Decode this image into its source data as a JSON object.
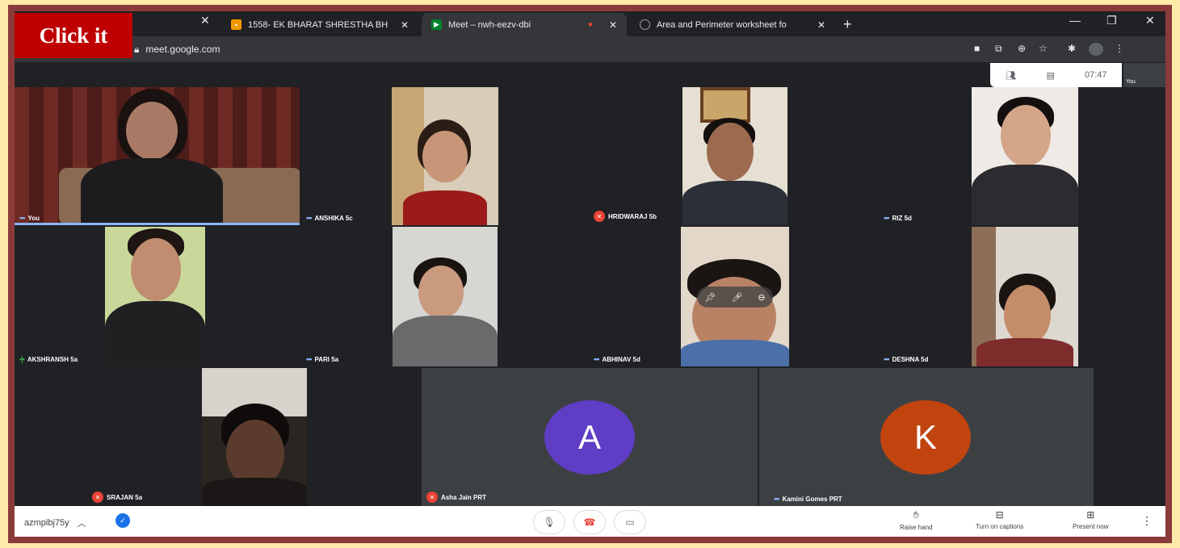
{
  "overlay": {
    "click_label": "Click it"
  },
  "browser": {
    "tabs": [
      {
        "title": "1558- EK BHARAT SHRESTHA BH",
        "icon": "slides-icon",
        "color": "#f29900"
      },
      {
        "title": "Meet – nwh-eezv-dbi",
        "icon": "meet-icon",
        "color": "#00832d"
      },
      {
        "title": "Area and Perimeter worksheet fo",
        "icon": "globe-icon",
        "color": "#9aa0a6"
      }
    ],
    "close_glyph": "✕",
    "new_tab_glyph": "+",
    "url": "meet.google.com"
  },
  "meet_panel": {
    "time": "07:47",
    "self_label": "You"
  },
  "participants": [
    {
      "name": "You",
      "speaking": true
    },
    {
      "name": "ANSHIKA 5c"
    },
    {
      "name": "HRIDWARAJ 5b",
      "muted": true
    },
    {
      "name": "RIZ 5d"
    },
    {
      "name": "AKSHRANSH 5a"
    },
    {
      "name": "PARI 5a"
    },
    {
      "name": "ABHINAV 5d"
    },
    {
      "name": "DESHNA 5d"
    },
    {
      "name": "SRAJAN 5a",
      "muted": true
    },
    {
      "name": "Asha Jain PRT",
      "muted": true,
      "initial": "A",
      "color": "#5f3dc4"
    },
    {
      "name": "Kamini Gomes PRT",
      "initial": "K",
      "color": "#c1440e"
    }
  ],
  "bottom_bar": {
    "meeting_code": "azmplbj75y",
    "raise_hand": "Raise hand",
    "captions": "Turn on captions",
    "present": "Present now"
  },
  "colors": {
    "accent": "#1a73e8",
    "mute_red": "#ea4335",
    "frame_border": "#8b3a3a",
    "click_red": "#c00000"
  }
}
